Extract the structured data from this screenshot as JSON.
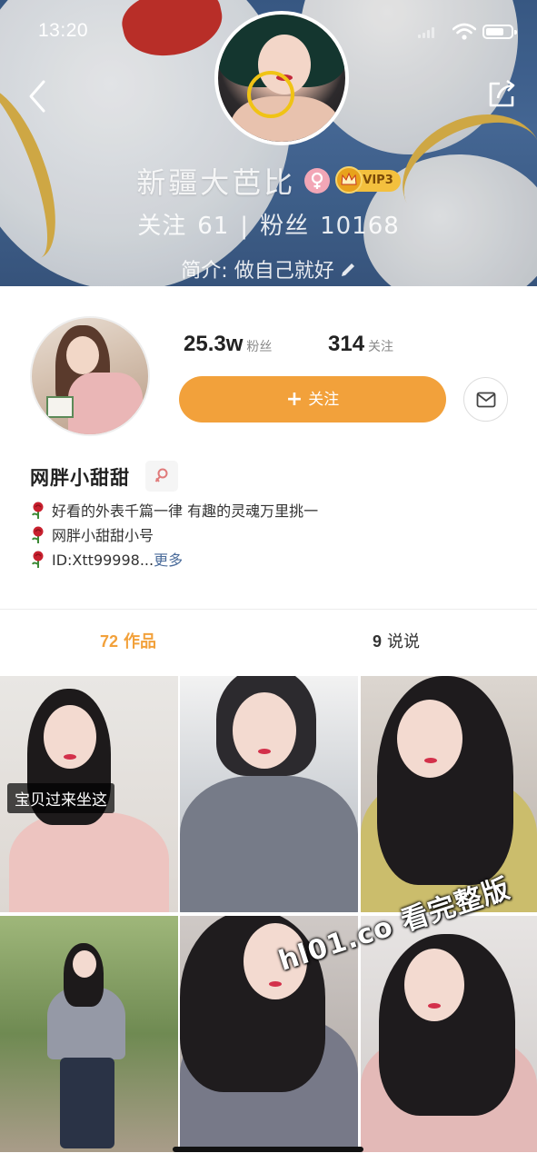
{
  "status_bar": {
    "time": "13:20"
  },
  "banner": {
    "name": "新疆大芭比",
    "vip": "VIP3",
    "follow_label": "关注",
    "follow_count": "61",
    "separator": "|",
    "fans_label": "粉丝",
    "fans_count": "10168",
    "bio": "简介: 做自己就好"
  },
  "profile": {
    "fans_num": "25.3w",
    "fans_label": "粉丝",
    "following_num": "314",
    "following_label": "关注",
    "follow_button": "关注",
    "name": "网胖小甜甜",
    "bio_lines": [
      "好看的外表千篇一律 有趣的灵魂万里挑一",
      "网胖小甜甜小号",
      "ID:Xtt99998..."
    ],
    "more": "更多"
  },
  "tabs": {
    "works_count": "72",
    "works_label": "作品",
    "posts_count": "9",
    "posts_label": "说说"
  },
  "grid": {
    "caption": "宝贝过来坐这"
  },
  "watermark": "hl01.co 看完整版",
  "colors": {
    "accent": "#f2a13b",
    "link": "#4a6b9a",
    "vip_gold": "#f3c03e"
  },
  "icons": [
    "back-arrow-icon",
    "share-icon",
    "female-icon",
    "crown-icon",
    "pencil-icon",
    "plus-icon",
    "mail-icon",
    "rose-icon",
    "signal-icon",
    "wifi-icon",
    "battery-icon"
  ]
}
